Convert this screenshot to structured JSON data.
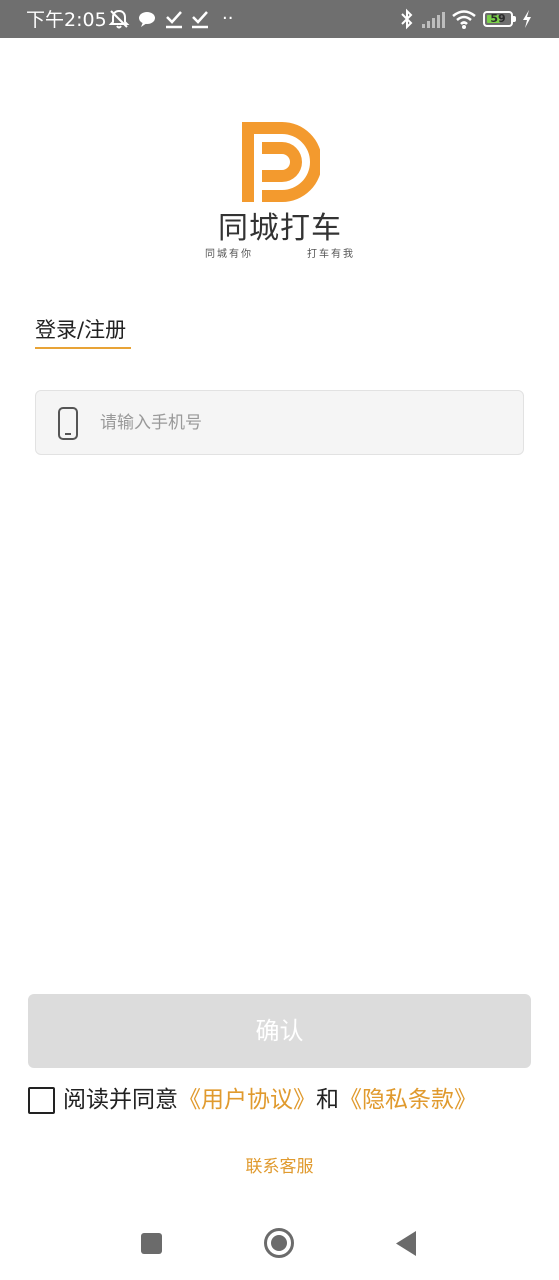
{
  "status_bar": {
    "time": "下午2:05",
    "dots": "··",
    "battery_level": "59",
    "battery_fraction": 0.59,
    "icons": [
      "mute-bell-icon",
      "chat-bubble-icon",
      "check-download-icon",
      "check-download-icon",
      "bluetooth-icon",
      "signal-icon",
      "wifi-icon",
      "battery-icon",
      "charging-icon"
    ]
  },
  "brand": {
    "name": "同城打车",
    "slogan_left": "同城有你",
    "slogan_right": "打车有我",
    "accent_color": "#F39A2E"
  },
  "login": {
    "tab_label": "登录/注册",
    "phone_placeholder": "请输入手机号",
    "phone_value": ""
  },
  "confirm_button": {
    "label": "确认",
    "enabled": false
  },
  "agreement": {
    "checked": false,
    "prefix": "阅读并同意",
    "user_agreement": "《用户协议》",
    "connector": "和",
    "privacy_terms": "《隐私条款》"
  },
  "support": {
    "label": "联系客服"
  },
  "nav_bar": {
    "icons": [
      "recent-apps-icon",
      "home-icon",
      "back-icon"
    ]
  }
}
